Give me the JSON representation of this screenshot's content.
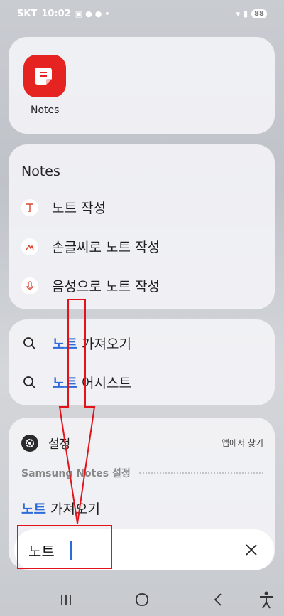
{
  "status_bar": {
    "carrier": "SKT",
    "time": "10:02",
    "battery": "88"
  },
  "app_card": {
    "app_name": "Notes",
    "icon": "notes-app-icon",
    "accent_color": "#e52422"
  },
  "actions_card": {
    "title": "Notes",
    "items": [
      {
        "label": "노트 작성",
        "icon": "text-icon"
      },
      {
        "label": "손글씨로 노트 작성",
        "icon": "handwriting-icon"
      },
      {
        "label": "음성으로 노트 작성",
        "icon": "microphone-icon"
      }
    ]
  },
  "search_results": {
    "items": [
      {
        "highlight": "노트",
        "rest": " 가져오기",
        "icon": "search-icon"
      },
      {
        "highlight": "노트",
        "rest": " 어시스트",
        "icon": "search-icon"
      }
    ]
  },
  "settings_card": {
    "title": "설정",
    "find_in_app": "앱에서 찾기",
    "subsection": "Samsung Notes 설정",
    "result": {
      "highlight": "노트",
      "rest": " 가져오기"
    }
  },
  "search_bar": {
    "value": "노트",
    "clear_icon": "close-icon"
  },
  "colors": {
    "highlight": "#2f6bd8",
    "annotation": "#e3121b"
  }
}
